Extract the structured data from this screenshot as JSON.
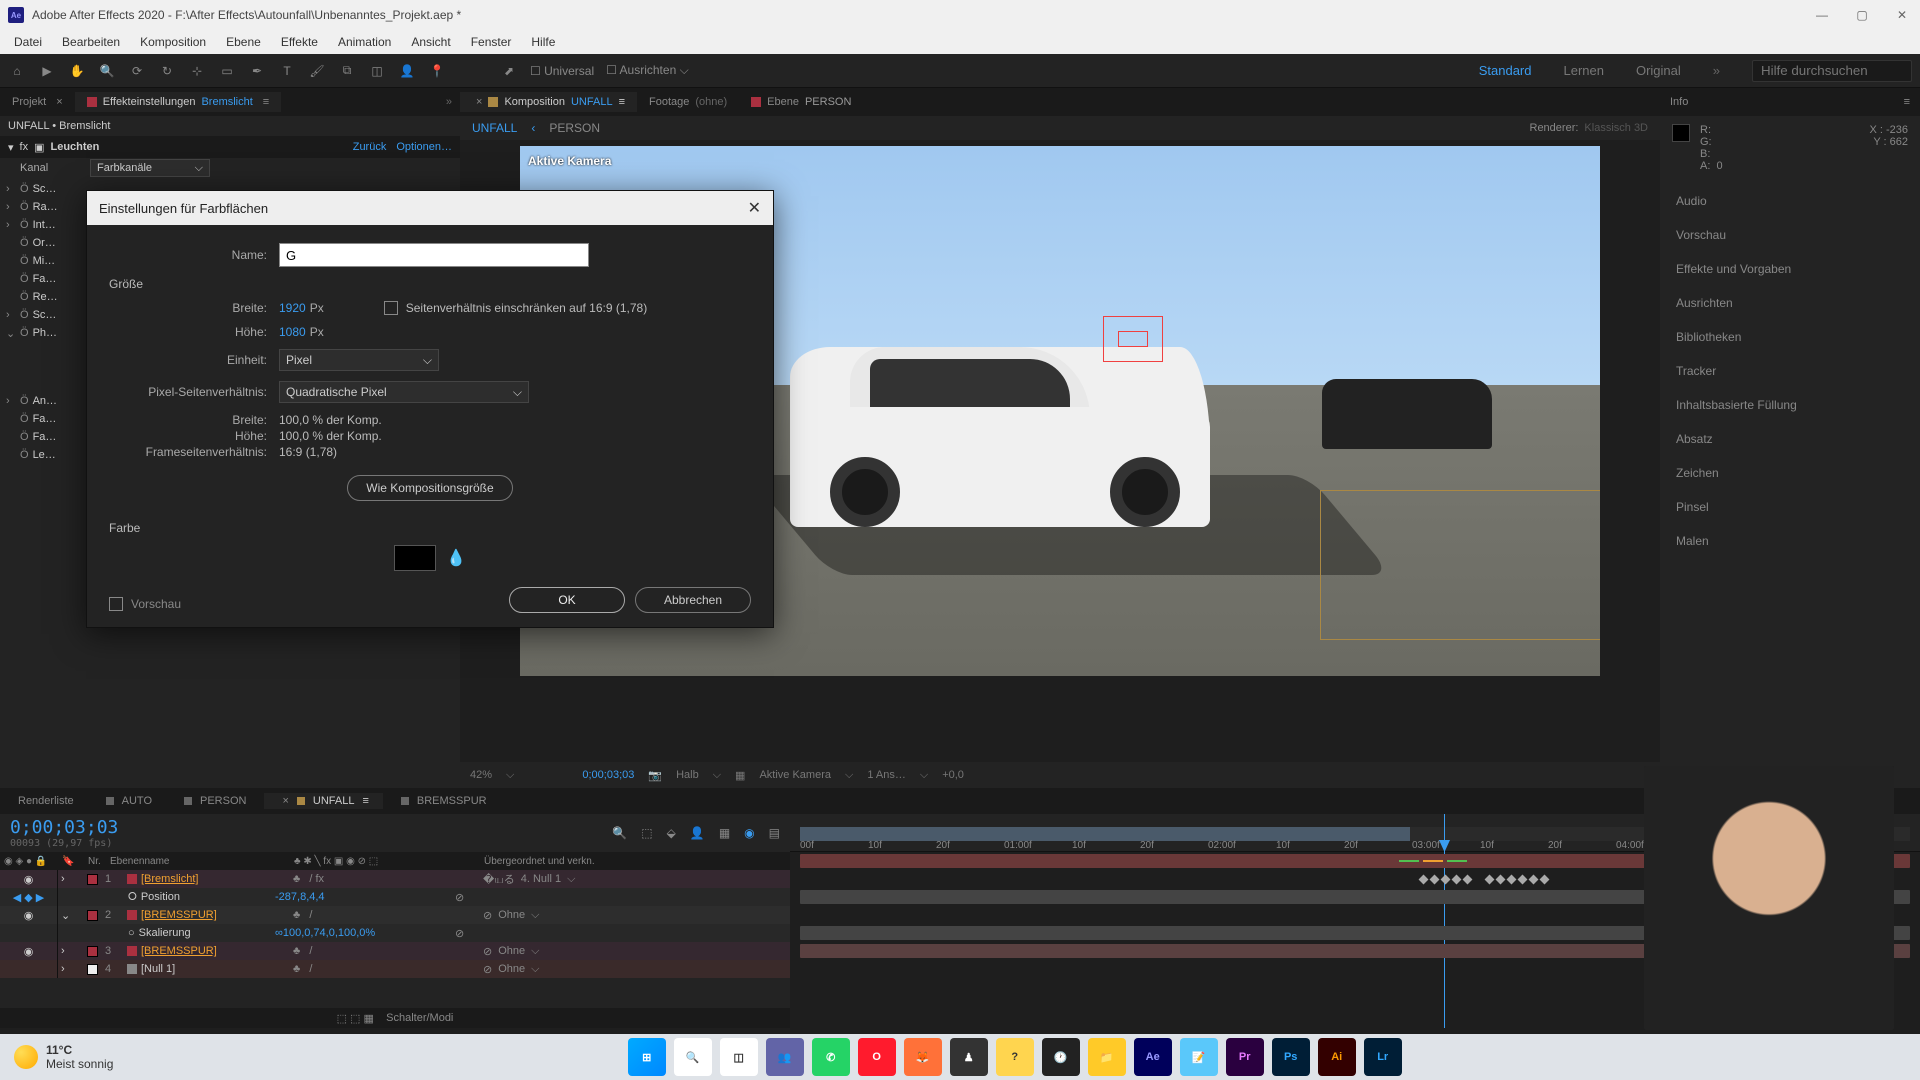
{
  "titlebar": {
    "app": "Adobe After Effects 2020",
    "path": "F:\\After Effects\\Autounfall\\Unbenanntes_Projekt.aep *"
  },
  "menu": [
    "Datei",
    "Bearbeiten",
    "Komposition",
    "Ebene",
    "Effekte",
    "Animation",
    "Ansicht",
    "Fenster",
    "Hilfe"
  ],
  "toolbar": {
    "universal": "Universal",
    "align": "Ausrichten",
    "workspaces": {
      "standard": "Standard",
      "learn": "Lernen",
      "original": "Original"
    },
    "search_ph": "Hilfe durchsuchen"
  },
  "left": {
    "tabs": {
      "project": "Projekt",
      "effects": "Effekteinstellungen",
      "effects_target": "Bremslicht"
    },
    "breadcrumb": "UNFALL • Bremslicht",
    "fx": {
      "name": "Leuchten",
      "back": "Zurück",
      "opts": "Optionen…",
      "channel_lbl": "Kanal",
      "channel_val": "Farbkanäle"
    },
    "tree": [
      "Sc…",
      "Ra…",
      "Int…",
      "Or…",
      "Mi…",
      "Fa…",
      "Re…",
      "Sc…",
      "Ph…"
    ],
    "tree2": [
      "An…",
      "Fa…",
      "Fa…",
      "Le…"
    ]
  },
  "center": {
    "tabs": {
      "comp_label": "Komposition",
      "comp_name": "UNFALL",
      "footage": "Footage",
      "footage_none": "(ohne)",
      "layer": "Ebene",
      "layer_name": "PERSON"
    },
    "bc": {
      "a": "UNFALL",
      "b": "PERSON"
    },
    "renderer_lbl": "Renderer:",
    "renderer_val": "Klassisch 3D",
    "cam": "Aktive Kamera",
    "ctrl": {
      "zoom": "42%",
      "time": "0;00;03;03",
      "half": "Halb",
      "cam": "Aktive Kamera",
      "views": "1 Ans…",
      "exp": "+0,0"
    }
  },
  "right": {
    "info": "Info",
    "rgb": {
      "r": "R:",
      "g": "G:",
      "b": "B:",
      "a": "A:",
      "aval": "0"
    },
    "xy": {
      "x": "X : -236",
      "y": "Y : 662"
    },
    "panels": [
      "Audio",
      "Vorschau",
      "Effekte und Vorgaben",
      "Ausrichten",
      "Bibliotheken",
      "Tracker",
      "Inhaltsbasierte Füllung",
      "Absatz",
      "Zeichen",
      "Pinsel",
      "Malen"
    ]
  },
  "timeline": {
    "tabs": {
      "render": "Renderliste",
      "auto": "AUTO",
      "person": "PERSON",
      "unfall": "UNFALL",
      "bremsspur": "BREMSSPUR"
    },
    "time": "0;00;03;03",
    "time_sub": "00093 (29,97 fps)",
    "cols": {
      "nr": "Nr.",
      "name": "Ebenenname",
      "parent": "Übergeordnet und verkn."
    },
    "layers": [
      {
        "n": "1",
        "name": "[Bremslicht]",
        "parent": "4. Null 1",
        "color": "#aa3040"
      },
      {
        "prop": true,
        "name": "Position",
        "val": "-287,8,4,4"
      },
      {
        "n": "2",
        "name": "[BREMSSPUR]",
        "parent": "Ohne",
        "color": "#aa3040"
      },
      {
        "prop": true,
        "name": "Skalierung",
        "val": "100,0,74,0,100,0%"
      },
      {
        "n": "3",
        "name": "[BREMSSPUR]",
        "parent": "Ohne",
        "color": "#aa3040"
      },
      {
        "n": "4",
        "name": "[Null 1]",
        "parent": "Ohne",
        "color": "#eee"
      }
    ],
    "footer": "Schalter/Modi",
    "ticks": [
      "00f",
      "10f",
      "20f",
      "01:00f",
      "10f",
      "20f",
      "02:00f",
      "10f",
      "20f",
      "03:00f",
      "10f",
      "20f",
      "04:00f"
    ]
  },
  "dialog": {
    "title": "Einstellungen für Farbflächen",
    "name_lbl": "Name:",
    "name_val": "G",
    "size_hdr": "Größe",
    "w_lbl": "Breite:",
    "w_val": "1920",
    "px": "Px",
    "h_lbl": "Höhe:",
    "h_val": "1080",
    "lock": "Seitenverhältnis einschränken auf 16:9 (1,78)",
    "unit_lbl": "Einheit:",
    "unit_val": "Pixel",
    "par_lbl": "Pixel-Seitenverhältnis:",
    "par_val": "Quadratische Pixel",
    "info_w": "Breite:",
    "info_wv": "100,0 % der Komp.",
    "info_h": "Höhe:",
    "info_hv": "100,0 % der Komp.",
    "info_f": "Frameseitenverhältnis:",
    "info_fv": "16:9 (1,78)",
    "compsize": "Wie Kompositionsgröße",
    "color_hdr": "Farbe",
    "color_val": "#000000",
    "preview": "Vorschau",
    "ok": "OK",
    "cancel": "Abbrechen"
  },
  "taskbar": {
    "temp": "11°C",
    "cond": "Meist sonnig",
    "apps": [
      "Win",
      "Search",
      "Tasks",
      "Teams",
      "WA",
      "Op",
      "FF",
      "Fig",
      "Hlp",
      "Clk",
      "Files",
      "Ae",
      "Note",
      "Pr",
      "Ps",
      "Ai",
      "Lr"
    ]
  }
}
